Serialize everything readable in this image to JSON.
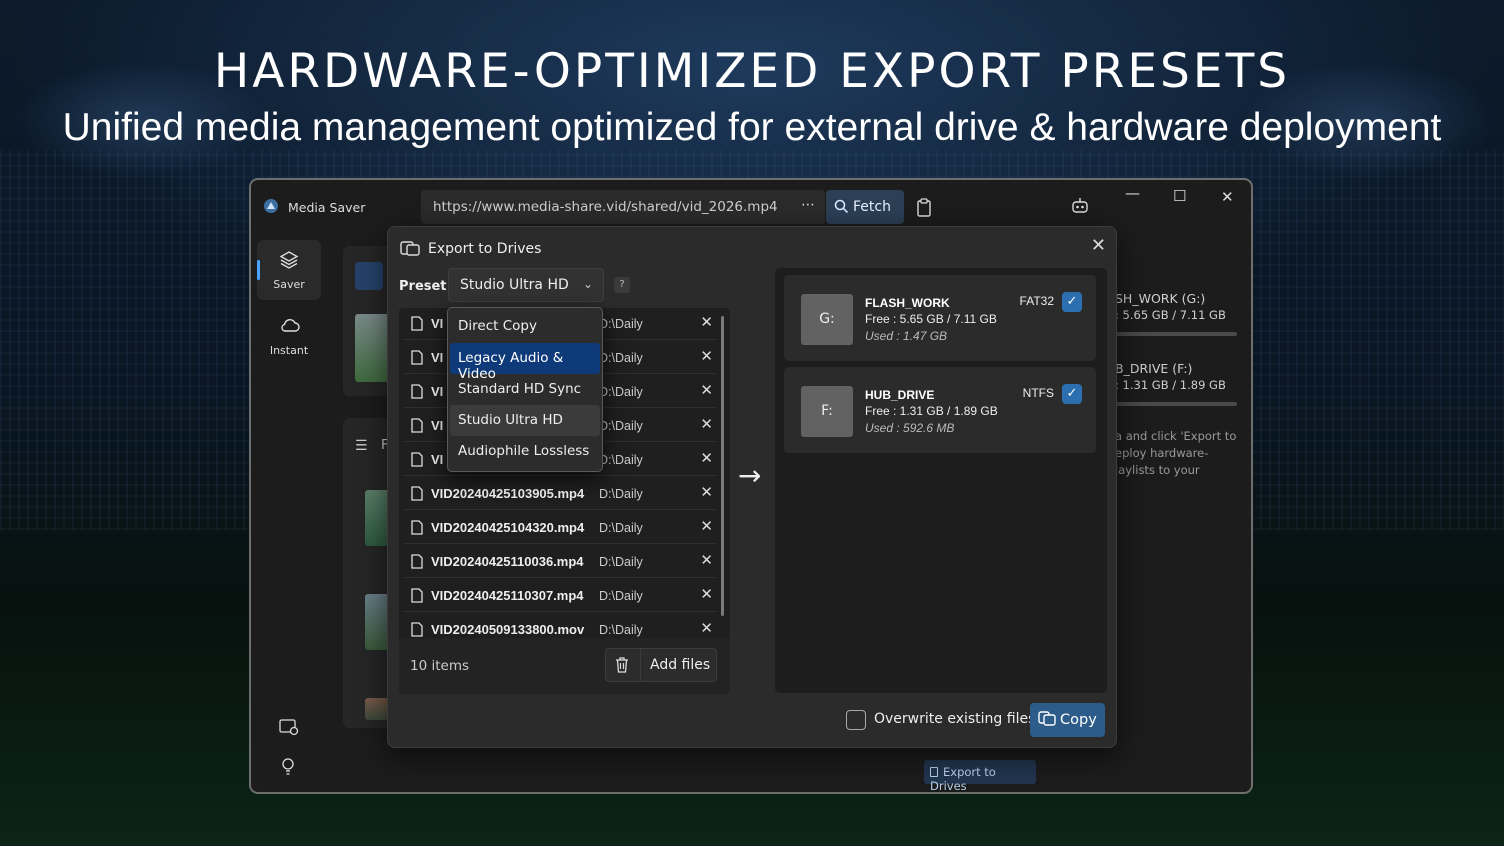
{
  "banner": {
    "headline": "HARDWARE-OPTIMIZED EXPORT PRESETS",
    "subline": "Unified media management optimized for external drive & hardware deployment"
  },
  "window": {
    "app_title": "Media Saver",
    "url": "https://www.media-share.vid/shared/vid_2026.mp4",
    "more": "⋯",
    "fetch_label": "Fetch",
    "minimize": "—",
    "maximize": "☐",
    "close": "✕"
  },
  "sidebar": {
    "items": [
      {
        "label": "Saver",
        "icon": "layers-icon"
      },
      {
        "label": "Instant",
        "icon": "cloud-icon"
      }
    ]
  },
  "background": {
    "list_header": "F",
    "drive1_name": "SH_WORK (G:)",
    "drive1_space": ": 5.65 GB / 7.11 GB",
    "drive2_name": "B_DRIVE (F:)",
    "drive2_space": ": 1.31 GB / 1.89 GB",
    "hint_line1": "a and click 'Export to",
    "hint_line2": "eploy hardware-",
    "hint_line3": "laylists to your",
    "export_button": "Export to Drives"
  },
  "dialog": {
    "title": "Export to Drives",
    "close": "✕",
    "preset_label": "Preset",
    "preset_value": "Studio Ultra HD",
    "help": "?",
    "dropdown_options": [
      "Direct Copy",
      "Legacy Audio & Video",
      "Standard HD Sync",
      "Studio Ultra HD",
      "Audiophile Lossless"
    ],
    "highlighted_option": "Legacy Audio & Video",
    "files": [
      {
        "name": "VI",
        "path": "D:\\Daily"
      },
      {
        "name": "VI",
        "path": "D:\\Daily"
      },
      {
        "name": "VI",
        "path": "D:\\Daily"
      },
      {
        "name": "VI",
        "path": "D:\\Daily"
      },
      {
        "name": "VI",
        "path": "D:\\Daily"
      },
      {
        "name": "VID20240425103905.mp4",
        "path": "D:\\Daily"
      },
      {
        "name": "VID20240425104320.mp4",
        "path": "D:\\Daily"
      },
      {
        "name": "VID20240425110036.mp4",
        "path": "D:\\Daily"
      },
      {
        "name": "VID20240425110307.mp4",
        "path": "D:\\Daily"
      },
      {
        "name": "VID20240509133800.mov",
        "path": "D:\\Daily"
      }
    ],
    "items_count": "10 items",
    "add_files": "Add files",
    "arrow": "→",
    "drives": [
      {
        "letter": "G:",
        "name": "FLASH_WORK",
        "free": "Free :  5.65 GB  /  7.11 GB",
        "used": "Used :  1.47 GB",
        "fs": "FAT32",
        "checked": true
      },
      {
        "letter": "F:",
        "name": "HUB_DRIVE",
        "free": "Free :  1.31 GB  /  1.89 GB",
        "used": "Used :  592.6 MB",
        "fs": "NTFS",
        "checked": true
      }
    ],
    "overwrite_label": "Overwrite existing files",
    "overwrite_checked": false,
    "copy_label": "Copy"
  },
  "colors": {
    "accent": "#2c6fb0",
    "highlight": "#0e3a7a"
  }
}
